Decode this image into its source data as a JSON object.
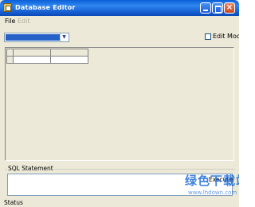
{
  "window": {
    "title": "Database Editor"
  },
  "titlebar": {
    "minimize": "",
    "maximize": "",
    "close": "×"
  },
  "menu": {
    "file": "File",
    "edit": "Edit"
  },
  "toolbar": {
    "database_select_value": "",
    "edit_mode_label": "Edit Mode",
    "edit_mode_checked": false
  },
  "grid": {
    "columns": [
      "",
      ""
    ],
    "rows": []
  },
  "sql": {
    "group_label": "SQL Statement",
    "statement": "",
    "execute_label": "Execute"
  },
  "statusbar": {
    "text": "Status"
  },
  "watermark": {
    "line1": "绿色下载站",
    "line2": "www.lhdown.com"
  },
  "colors": {
    "title_bar": "#1a64d6",
    "window_bg": "#ece9d8",
    "selection": "#2561c7"
  }
}
